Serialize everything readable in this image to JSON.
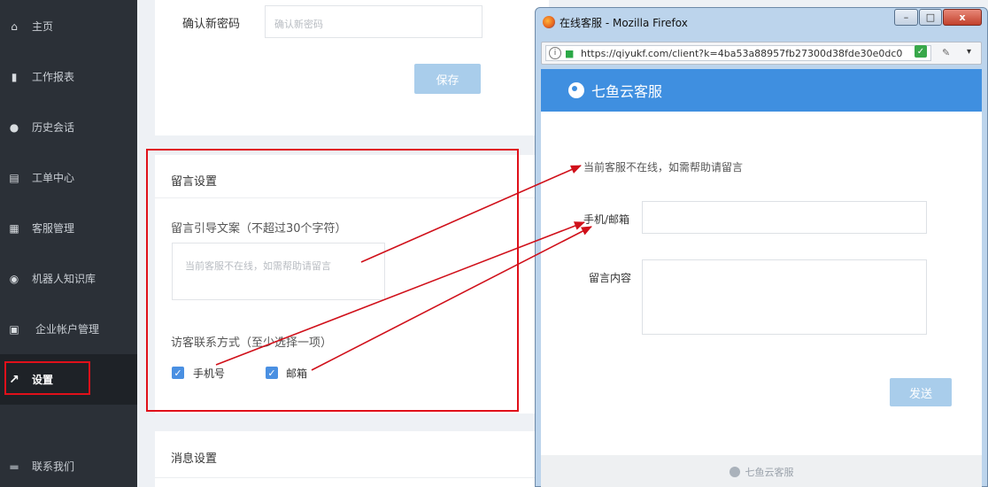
{
  "sidebar": {
    "items": [
      {
        "label": "主页",
        "icon": "home-icon",
        "glyph": "⌂"
      },
      {
        "label": "工作报表",
        "icon": "bar-chart-icon",
        "glyph": "▮"
      },
      {
        "label": "历史会话",
        "icon": "clock-icon",
        "glyph": "●"
      },
      {
        "label": "工单中心",
        "icon": "ticket-icon",
        "glyph": "▤"
      },
      {
        "label": "客服管理",
        "icon": "agents-icon",
        "glyph": "▦"
      },
      {
        "label": "机器人知识库",
        "icon": "robot-icon",
        "glyph": "◉"
      },
      {
        "label": "企业帐户管理",
        "icon": "account-icon",
        "glyph": "▣"
      },
      {
        "label": "设置",
        "icon": "settings-wrench-icon",
        "glyph": "↗",
        "active": true
      },
      {
        "label": "联系我们",
        "icon": "contact-icon",
        "glyph": "▬"
      }
    ]
  },
  "password": {
    "confirm_label": "确认新密码",
    "confirm_placeholder": "确认新密码",
    "save_label": "保存"
  },
  "leave_message": {
    "title": "留言设置",
    "guide_label": "留言引导文案（不超过30个字符）",
    "guide_placeholder": "当前客服不在线，如需帮助请留言",
    "contact_label": "访客联系方式（至少选择一项）",
    "options": [
      {
        "label": "手机号",
        "checked": true
      },
      {
        "label": "邮箱",
        "checked": true
      }
    ]
  },
  "message_settings": {
    "title": "消息设置"
  },
  "firefox": {
    "title": "在线客服 - Mozilla Firefox",
    "url": "https://qiyukf.com/client?k=4ba53a88957fb27300d38fde30e0dc0",
    "brand": "七鱼云客服",
    "offline_text": "当前客服不在线，如需帮助请留言",
    "phone_email_label": "手机/邮箱",
    "content_label": "留言内容",
    "send_label": "发送",
    "footer_brand": "七鱼云客服",
    "minimize": "–",
    "maximize": "□",
    "close": "x"
  },
  "colors": {
    "sidebar_bg": "#2b3037",
    "accent": "#4a90e2",
    "annotation_red": "#e0101a",
    "header_blue": "#3f8fe0",
    "disabled_button": "#a9cdeb"
  }
}
